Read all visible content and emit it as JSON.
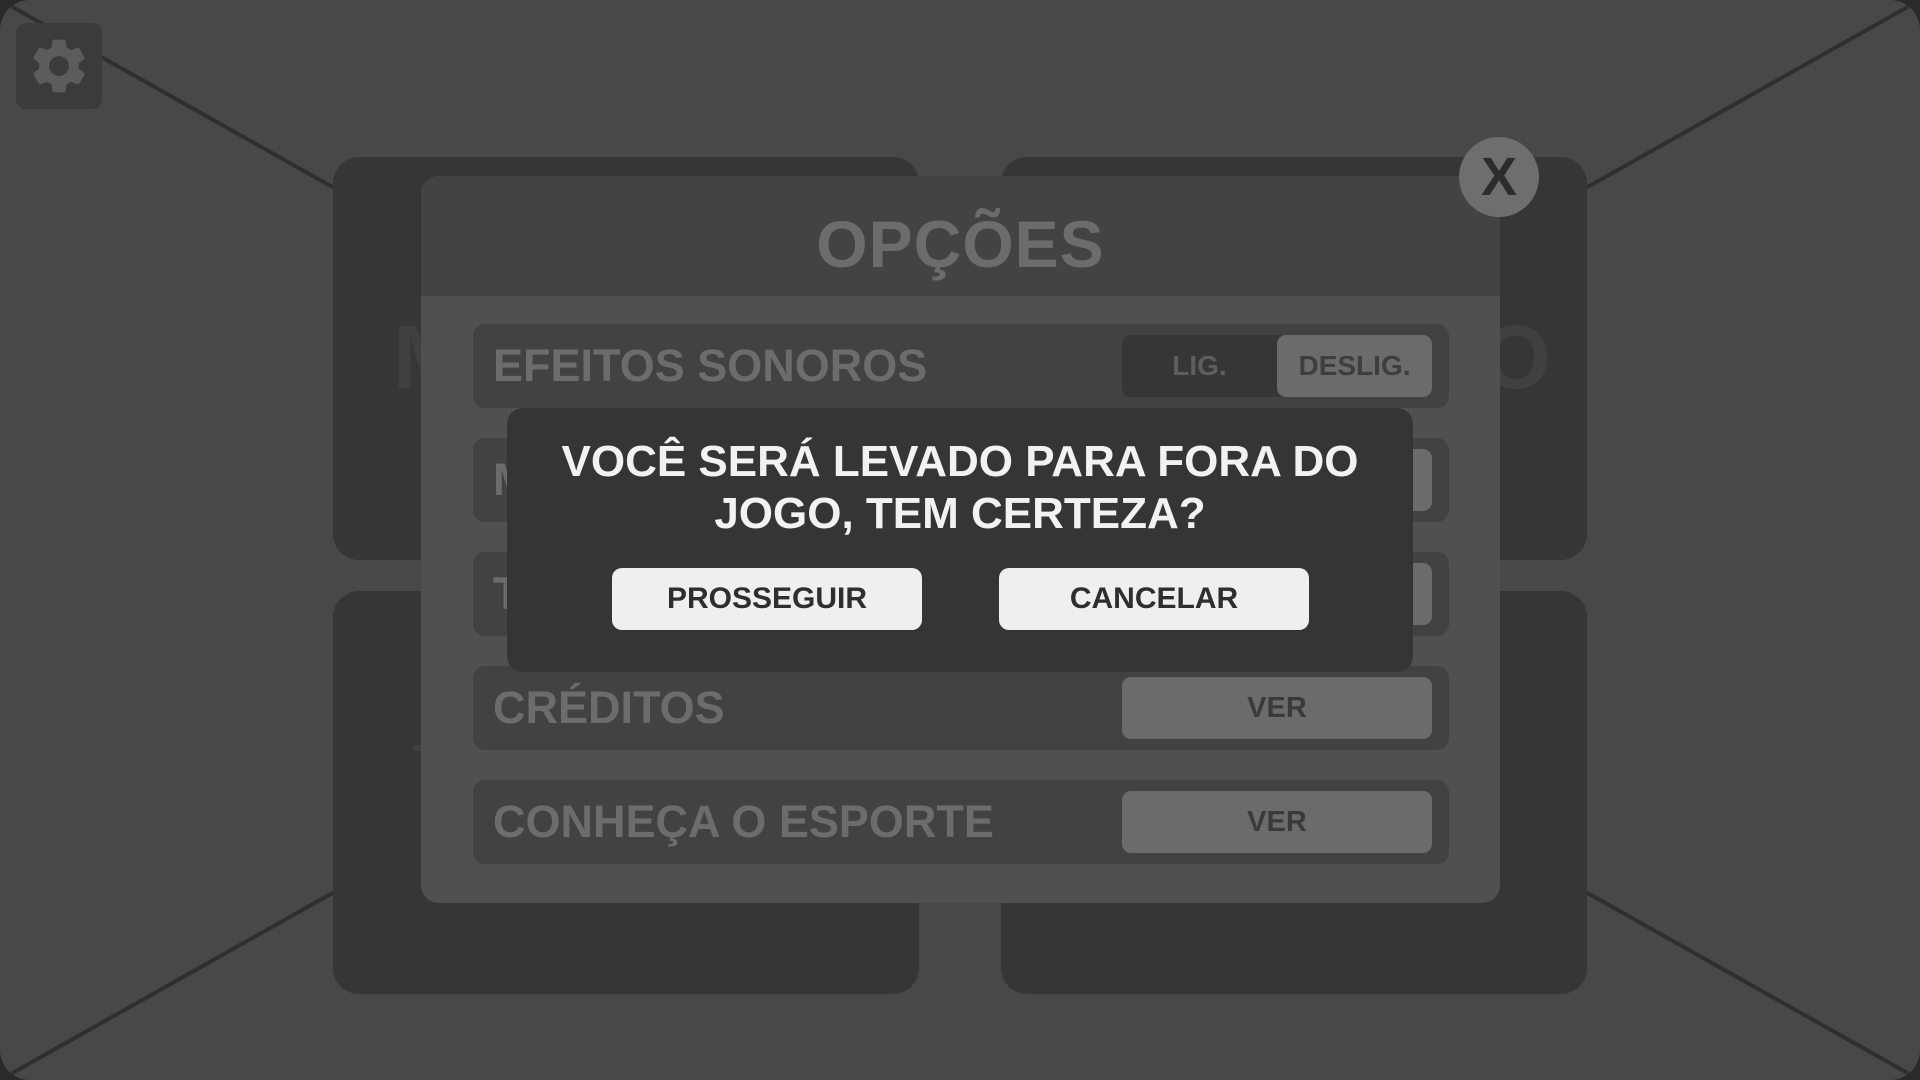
{
  "options": {
    "title": "OPÇÕES",
    "close_label": "X",
    "rows": [
      {
        "label": "EFEITOS SONOROS",
        "toggle_on": "LIG.",
        "toggle_off": "DESLIG.",
        "state": "off"
      },
      {
        "label": "M"
      },
      {
        "label": "T"
      },
      {
        "label": "CRÉDITOS",
        "button": "VER"
      },
      {
        "label": "CONHEÇA O ESPORTE",
        "button": "VER"
      }
    ]
  },
  "background": {
    "card_letters": [
      "M",
      "O",
      "–"
    ]
  },
  "confirm": {
    "message": "VOCÊ SERÁ LEVADO PARA FORA DO JOGO, TEM CERTEZA?",
    "proceed_label": "PROSSEGUIR",
    "cancel_label": "CANCELAR"
  },
  "icons": {
    "settings": "gear-icon",
    "close": "close-icon"
  },
  "colors": {
    "screen_bg": "#484848",
    "panel_bg": "#505050",
    "dialog_bg": "#353535",
    "dialog_button_bg": "#efefef"
  }
}
